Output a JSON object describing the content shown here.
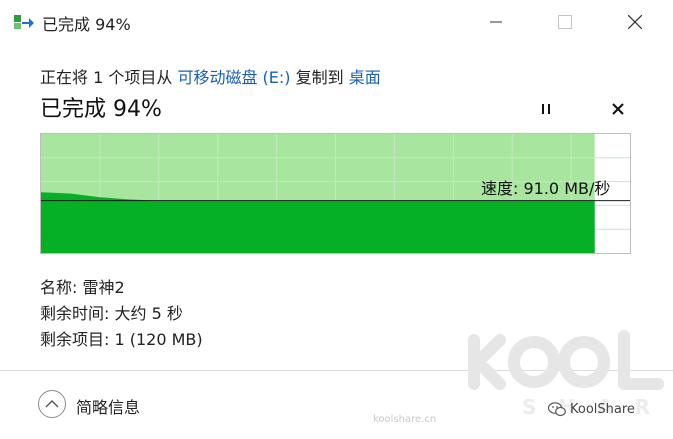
{
  "window": {
    "title": "已完成 94%"
  },
  "copy": {
    "prefix": "正在将 1 个项目从 ",
    "source": "可移动磁盘 (E:)",
    "middle": " 复制到 ",
    "destination": "桌面"
  },
  "progress": {
    "title": "已完成 94%",
    "percent": 94,
    "speed_label": "速度: 91.0 MB/秒"
  },
  "chart_data": {
    "type": "area",
    "completed_fraction": 0.94,
    "current_speed_fraction": 0.44,
    "speed_profile_fraction": [
      0.51,
      0.5,
      0.47,
      0.45,
      0.44,
      0.44,
      0.44,
      0.44,
      0.44,
      0.44,
      0.44,
      0.44,
      0.44,
      0.44,
      0.44,
      0.44,
      0.44,
      0.44,
      0.44,
      0.44
    ],
    "grid": true,
    "colors": {
      "completed_bg": "#a8e6a0",
      "speed_fill": "#06b025",
      "grid": "#c6e8c1",
      "speed_line": "#1b1b1b"
    }
  },
  "details": {
    "name": "名称: 雷神2",
    "time_remaining": "剩余时间: 大约 5 秒",
    "items_remaining": "剩余项目: 1 (120 MB)"
  },
  "footer": {
    "less_info": "简略信息"
  },
  "watermark": {
    "site": "koolshare.cn",
    "brand": "KoolShare",
    "logo_text": "KOOL SHARE"
  },
  "icons": {
    "app": "copy-transfer-icon",
    "minimize": "minimize-icon",
    "maximize": "maximize-icon",
    "close": "close-icon",
    "pause": "pause-icon",
    "cancel": "cancel-icon",
    "chevron": "chevron-up-icon"
  }
}
